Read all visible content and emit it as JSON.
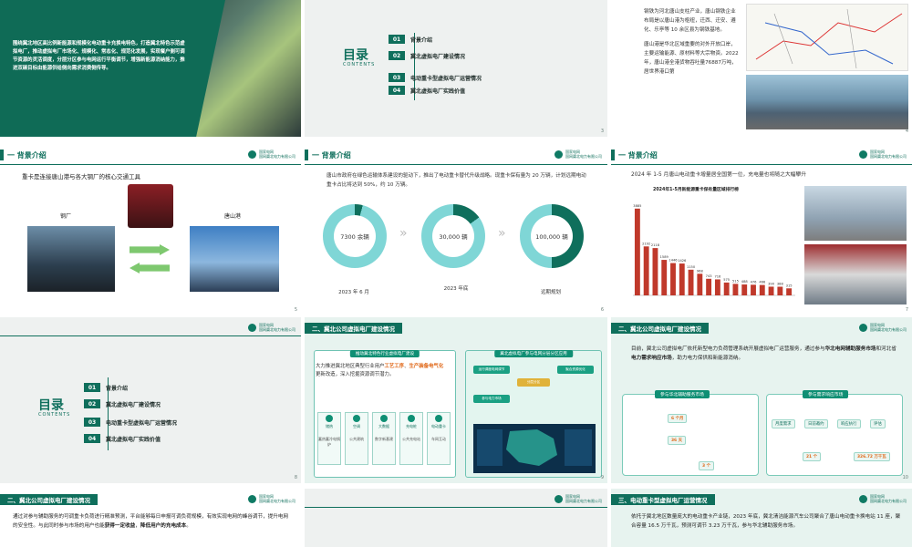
{
  "slide1": {
    "text": "围绕冀北地区高比例新能源和规模化电动重卡充换电特色，打造冀北特色示范虚拟电厂，推动虚拟电厂市场化、规模化、常态化、规范化发展，实现餐户侧可调节资源的灵活调度，分层分区参与电网运行平衡调节，增强新能源消纳能力，推进双碳目标由能源供给侧向需求消费侧传导。",
    "page": ""
  },
  "toc": {
    "title": "目录",
    "subtitle": "CONTENTS",
    "items": [
      {
        "num": "01",
        "label": "背景介绍"
      },
      {
        "num": "02",
        "label": "冀北虚拟电厂建设情况"
      },
      {
        "num": "03",
        "label": "电动重卡型虚拟电厂运营情况"
      },
      {
        "num": "04",
        "label": "冀北虚拟电厂实践价值"
      }
    ],
    "page_s2": "3",
    "page_s7": "8"
  },
  "logo": {
    "name": "国家电网",
    "en": "State Grid",
    "company": "国网冀北电力有限公司"
  },
  "slide3": {
    "text1": "钢铁为河北唐山支柱产业，唐山钢铁企业布局是以唐山港为枢纽，迁西、迁安、遵化、乐亭等 10 余区县为钢铁基地。",
    "text2": "唐山港是华北区域重要的对外开放口岸，主要运输能源、原材料等大宗物资。2022年，唐山港全港货物吞吐量76887万吨，居世界港口第",
    "page": "4"
  },
  "slide4": {
    "section": "一 背景介绍",
    "heading": "重卡是连接唐山港与各大钢厂的核心交通工具",
    "left_label": "钢厂",
    "right_label": "唐山港",
    "page": "5"
  },
  "slide5": {
    "section": "一 背景介绍",
    "text": "唐山市政府在绿色运输体系建设的驱动下，推出了电动重卡替代升级战略。现重卡保有量为 20 万辆，计划远期电动重卡占比将达到 50%，约 10 万辆。",
    "rings": [
      {
        "value": "7300 余辆",
        "label": "2023 年 6 月",
        "fraction": 0.04
      },
      {
        "value": "30,000 辆",
        "label": "2023 年底",
        "fraction": 0.15
      },
      {
        "value": "100,000 辆",
        "label": "远期规划",
        "fraction": 0.5
      }
    ],
    "colors": {
      "ring_track": "#7fd6d6",
      "ring_fill": "#0f6f5c"
    },
    "page": "6"
  },
  "slide6": {
    "section": "一 背景介绍",
    "text": "2024 年 1-5 月唐山电动重卡增量居全国第一位，充电量也将随之大幅攀升",
    "chart_title": "2024年1-5月新能源重卡保有量区域排行榜",
    "page": "7"
  },
  "chart_data": {
    "type": "bar",
    "title": "2024年1-5月新能源重卡保有量区域排行榜",
    "values": [
      3885,
      2192,
      2118,
      1589,
      1446,
      1426,
      1150,
      968,
      743,
      716,
      575,
      515,
      488,
      476,
      466,
      390,
      388,
      315
    ],
    "ylim": [
      0,
      4000
    ],
    "color": "#c0392b"
  },
  "slide8": {
    "section": "二、冀北公司虚拟电厂建设情况",
    "left_title": "推动冀北特色行业虚拟电厂建设",
    "text_pre": "大力推进冀北地区典型行业用户",
    "hl1": "工艺工序",
    "text_mid": "、",
    "hl2": "生产装备电气化",
    "text_post": "更新改造，深入挖掘资源调节潜力。",
    "categories": [
      "储热",
      "空调",
      "大数据",
      "充电桩",
      "电动重卡"
    ],
    "cat_desc": [
      "蓄热蓄冷电锅炉",
      "公共建筑",
      "数字新基建",
      "公共充电站",
      "车网互动"
    ],
    "right_title": "冀北虚拟电厂参与电网分层分区应用",
    "hex": [
      "运行调度电网调节",
      "分层分区",
      "聚合资源优化",
      "参与电力市场"
    ],
    "page": "9"
  },
  "slide9": {
    "section": "二、冀北公司虚拟电厂建设情况",
    "intro_pre": "目前，冀北公司虚拟电厂依托新型电力负荷管理系统开展虚拟电厂运营服务，通过参与",
    "intro_hl1": "华北电网辅助服务市场",
    "intro_mid": "和河北省",
    "intro_hl2": "电力需求响应市场",
    "intro_post": "，助力电力保供和新能源消纳。",
    "box1_title": "参与华北辅助服务市场",
    "box2_title": "参与需求响应市场",
    "stats": [
      "6 个月",
      "36 天",
      "3 个",
      "21 个",
      "326.72 万千瓦"
    ],
    "steps": [
      "月度需求",
      "日前邀约",
      "响应执行",
      "评估"
    ],
    "page": "10"
  },
  "slide10": {
    "section": "二、冀北公司虚拟电厂建设情况",
    "text_pre": "通过对参与辅助服务的可调重卡负荷进行精准预测，平台能够每日申报可调负荷规模，有效实现电网的峰谷调节，提升电网的安全性。与此同时参与市场的用户也能",
    "hl1": "获得一定收益",
    "text_mid": "，",
    "hl2": "降低用户的充电成本",
    "text_post": "。"
  },
  "slide12": {
    "section": "三、电动重卡型虚拟电厂运营情况",
    "text": "依托于冀北地区数量庞大的电动重卡产业链，2023 年底，冀北清洁能源汽车公司聚合了唐山电动重卡换电站 11 座，聚合容量 16.5 万千瓦，预测可调节 3.23 万千瓦，参与华北辅助服务市场。"
  }
}
